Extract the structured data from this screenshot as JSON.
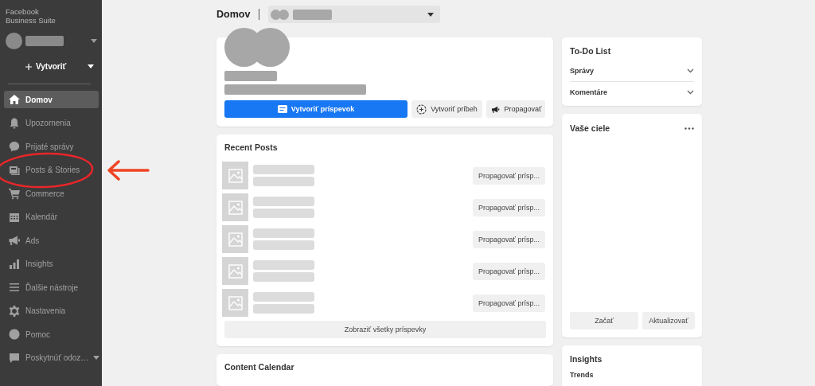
{
  "app": {
    "title": "Facebook Business Suite"
  },
  "sidebar": {
    "create_button": "Vytvoriť",
    "items": [
      {
        "label": "Domov",
        "selected": true
      },
      {
        "label": "Upozornenia",
        "selected": false
      },
      {
        "label": "Prijaté správy",
        "selected": false
      },
      {
        "label": "Posts & Stories",
        "selected": false
      },
      {
        "label": "Commerce",
        "selected": false
      },
      {
        "label": "Kalendár",
        "selected": false
      },
      {
        "label": "Ads",
        "selected": false
      },
      {
        "label": "Insights",
        "selected": false
      },
      {
        "label": "Ďalšie nástroje",
        "selected": false
      }
    ],
    "bottom_items": [
      {
        "label": "Nastavenia",
        "selected": false
      },
      {
        "label": "Pomoc",
        "selected": false
      },
      {
        "label": "Poskytnúť odoz…",
        "selected": false
      }
    ]
  },
  "header": {
    "title": "Domov"
  },
  "profile_card": {
    "buttons": [
      "Vytvoriť príspevok",
      "Vytvoriť príbeh",
      "Propagovať"
    ]
  },
  "recent_posts": {
    "title": "Recent Posts",
    "rows": [
      {
        "button": "Propagovať prísp..."
      },
      {
        "button": "Propagovať prísp..."
      },
      {
        "button": "Propagovať prísp..."
      },
      {
        "button": "Propagovať prísp..."
      },
      {
        "button": "Propagovať prísp..."
      }
    ],
    "show_all": "Zobraziť všetky príspevky"
  },
  "content_calendar": {
    "title": "Content Calendar"
  },
  "todo": {
    "title": "To-Do List",
    "items": [
      {
        "label": "Správy",
        "expanded": false
      },
      {
        "label": "Komentáre",
        "expanded": false
      }
    ]
  },
  "goals": {
    "title": "Vaše ciele",
    "buttons": [
      "Začať",
      "Aktualizovať"
    ]
  },
  "insights": {
    "title": "Insights",
    "subtitle": "Trends"
  }
}
